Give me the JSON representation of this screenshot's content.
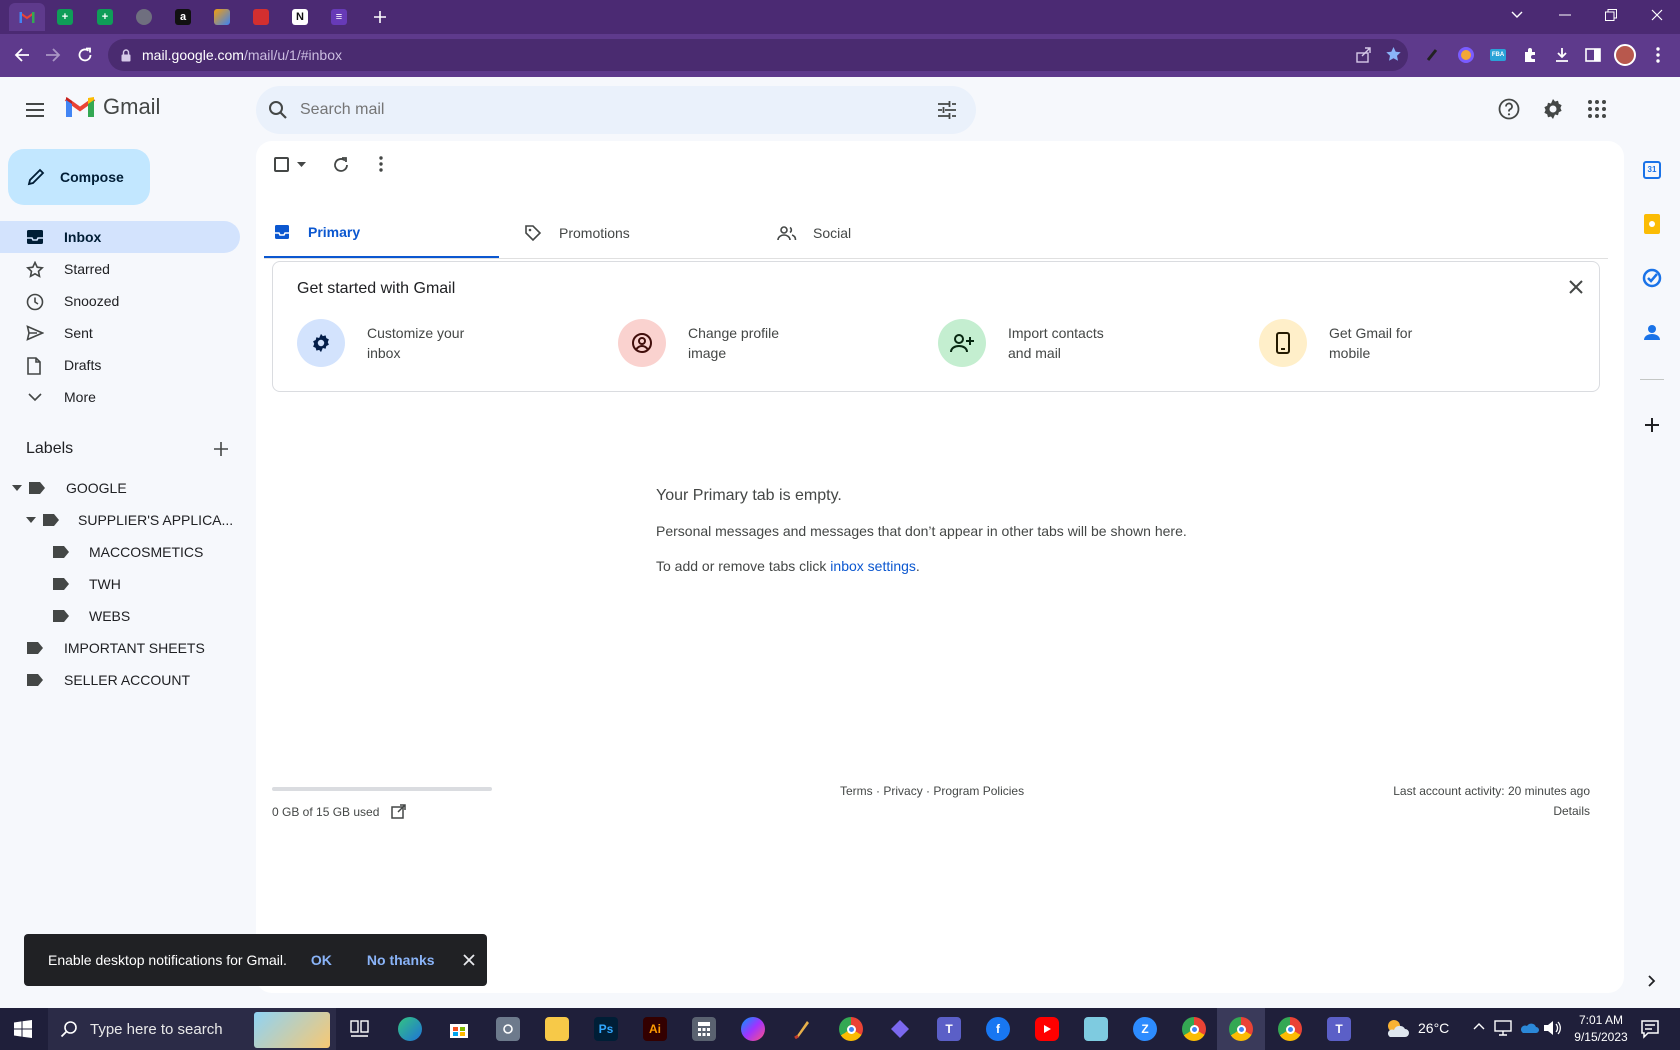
{
  "browser": {
    "url_host": "mail.google.com",
    "url_path": "/mail/u/1/#inbox",
    "tabs": [
      "gmail-icon",
      "sheets-icon",
      "sheets-icon",
      "globe-icon",
      "amazon-icon",
      "app-icon",
      "app-icon",
      "app-icon",
      "forms-icon"
    ]
  },
  "gmail": {
    "logo_text": "Gmail",
    "search_placeholder": "Search mail",
    "compose_label": "Compose",
    "nav": {
      "inbox": "Inbox",
      "starred": "Starred",
      "snoozed": "Snoozed",
      "sent": "Sent",
      "drafts": "Drafts",
      "more": "More"
    },
    "labels_title": "Labels",
    "labels": {
      "google": "GOOGLE",
      "supplier": "SUPPLIER'S APPLICA...",
      "maccosmetics": "MACCOSMETICS",
      "twh": "TWH",
      "webs": "WEBS",
      "important": "IMPORTANT SHEETS",
      "seller": "SELLER ACCOUNT"
    },
    "tabs": {
      "primary": "Primary",
      "promotions": "Promotions",
      "social": "Social"
    },
    "get_started": {
      "title": "Get started with Gmail",
      "customize_1": "Customize your",
      "customize_2": "inbox",
      "profile_1": "Change profile",
      "profile_2": "image",
      "import_1": "Import contacts",
      "import_2": "and mail",
      "mobile_1": "Get Gmail for",
      "mobile_2": "mobile"
    },
    "empty": {
      "title": "Your Primary tab is empty.",
      "line1": "Personal messages and messages that don’t appear in other tabs will be shown here.",
      "line2_prefix": "To add or remove tabs click ",
      "line2_link": "inbox settings",
      "line2_suffix": "."
    },
    "footer": {
      "storage": "0 GB of 15 GB used",
      "storage_fraction": 0.0,
      "terms": "Terms",
      "sep": "·",
      "privacy": "Privacy",
      "policies": "Program Policies",
      "activity": "Last account activity: 20 minutes ago",
      "details": "Details"
    },
    "snackbar": {
      "message": "Enable desktop notifications for Gmail.",
      "ok": "OK",
      "no_thanks": "No thanks"
    }
  },
  "taskbar": {
    "search_placeholder": "Type here to search",
    "weather": "26°C",
    "time": "7:01 AM",
    "date": "9/15/2023",
    "apps": [
      "task-view-icon",
      "edge-icon",
      "store-icon",
      "camera-icon",
      "explorer-icon",
      "photoshop-icon",
      "illustrator-icon",
      "calculator-icon",
      "messenger-icon",
      "paint-icon",
      "chrome-icon",
      "app-icon",
      "teams-icon",
      "facebook-icon",
      "youtube-icon",
      "notepad-icon",
      "zoom-icon",
      "chrome-icon",
      "chrome-icon",
      "chrome-icon",
      "teams-icon"
    ]
  },
  "colors": {
    "browser_frame": "#4b2a73",
    "accent_blue": "#0b57d0",
    "compose_bg": "#c2e7ff",
    "inbox_active_bg": "#d3e3fd"
  }
}
